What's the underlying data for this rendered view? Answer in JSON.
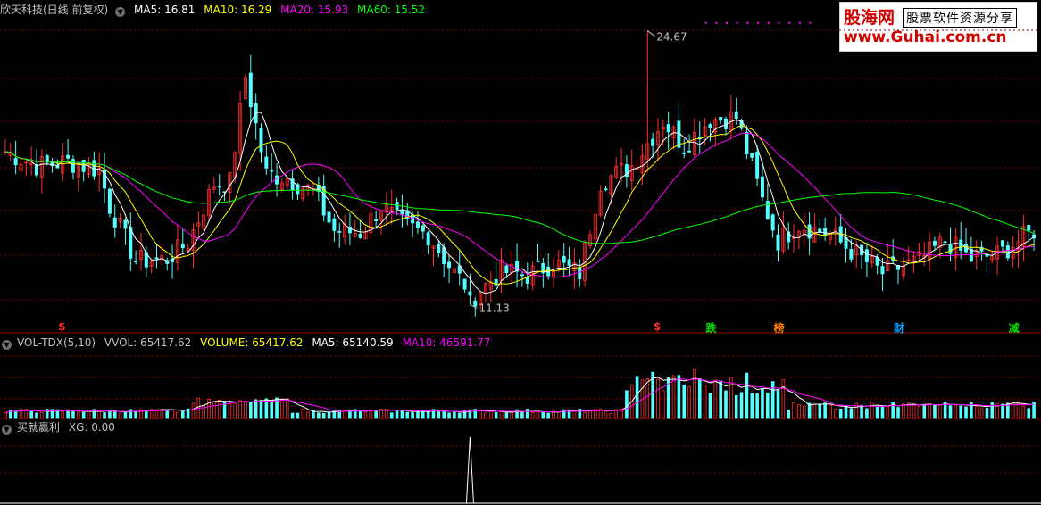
{
  "header": {
    "stock": "欣天科技(日线 前复权)",
    "ma": [
      {
        "label": "MA5: 16.81",
        "color": "#ffffff"
      },
      {
        "label": "MA10: 16.29",
        "color": "#ffff00"
      },
      {
        "label": "MA20: 15.93",
        "color": "#ff00ff"
      },
      {
        "label": "MA60: 15.52",
        "color": "#00ff00"
      }
    ]
  },
  "volume_header": {
    "name": "VOL-TDX(5,10)",
    "items": [
      {
        "label": "VVOL: 65417.62",
        "color": "#c0c0c0"
      },
      {
        "label": "VOLUME: 65417.62",
        "color": "#ffff00"
      },
      {
        "label": "MA5: 65140.59",
        "color": "#ffffff"
      },
      {
        "label": "MA10: 46591.77",
        "color": "#ff00ff"
      }
    ]
  },
  "indicator_header": {
    "name": "买就赢利",
    "items": [
      {
        "label": "XG: 0.00",
        "color": "#c0c0c0"
      }
    ]
  },
  "annotations": {
    "high": "24.67",
    "low": "11.13"
  },
  "markers": [
    {
      "text": "$",
      "color": "#ff3030",
      "idx": 11
    },
    {
      "text": "$",
      "color": "#ff3030",
      "idx": 125
    },
    {
      "text": "跌",
      "color": "#00e000",
      "idx": 135
    },
    {
      "text": "榜",
      "color": "#ff8000",
      "idx": 148
    },
    {
      "text": "财",
      "color": "#00a0ff",
      "idx": 171
    },
    {
      "text": "减",
      "color": "#00e000",
      "idx": 193
    }
  ],
  "watermark": {
    "line1": "股海网",
    "line1b": "股票软件资源分享",
    "line2": "www.Guhai.com.cn"
  },
  "colors": {
    "up": "#ff3030",
    "down": "#54ffff",
    "grid": "#800000",
    "ma5": "#ffffff",
    "ma10": "#ffff00",
    "ma20": "#ff00ff",
    "ma60": "#00ff00"
  },
  "chart_data": {
    "type": "candlestick",
    "count": 198,
    "ylim": [
      10.4,
      25.4
    ],
    "xg_signal_index": 89,
    "close_path": [
      [
        0,
        18.7
      ],
      [
        6,
        18.0
      ],
      [
        12,
        18.2
      ],
      [
        18,
        17.8
      ],
      [
        20,
        16.0
      ],
      [
        25,
        13.3
      ],
      [
        31,
        13.4
      ],
      [
        35,
        14.2
      ],
      [
        40,
        17.1
      ],
      [
        43,
        17.2
      ],
      [
        46,
        22.4
      ],
      [
        50,
        17.6
      ],
      [
        54,
        17.4
      ],
      [
        59,
        16.7
      ],
      [
        63,
        14.8
      ],
      [
        68,
        14.7
      ],
      [
        72,
        16.0
      ],
      [
        76,
        15.1
      ],
      [
        81,
        14.6
      ],
      [
        86,
        12.7
      ],
      [
        90,
        11.6
      ],
      [
        95,
        12.8
      ],
      [
        100,
        12.6
      ],
      [
        105,
        13.2
      ],
      [
        110,
        12.7
      ],
      [
        114,
        17.2
      ],
      [
        120,
        18.0
      ],
      [
        126,
        20.2
      ],
      [
        130,
        19.0
      ],
      [
        135,
        20.3
      ],
      [
        140,
        20.4
      ],
      [
        145,
        16.3
      ],
      [
        148,
        14.3
      ],
      [
        152,
        15.1
      ],
      [
        158,
        14.6
      ],
      [
        163,
        13.6
      ],
      [
        168,
        12.7
      ],
      [
        175,
        13.3
      ],
      [
        180,
        14.3
      ],
      [
        185,
        13.4
      ],
      [
        190,
        13.6
      ],
      [
        197,
        14.8
      ]
    ]
  }
}
